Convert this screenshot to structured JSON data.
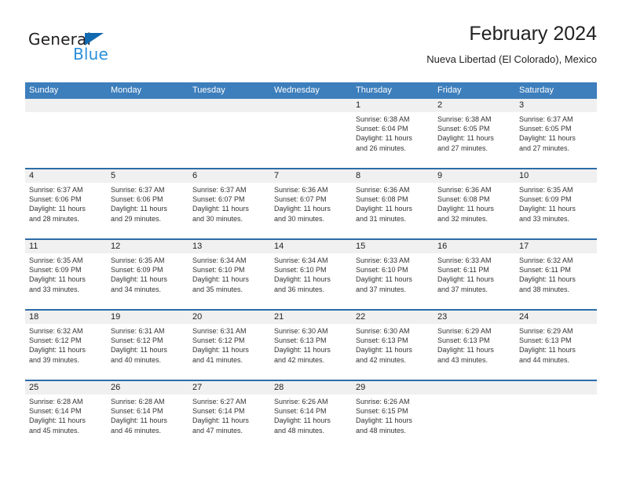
{
  "brand": {
    "name_top": "General",
    "name_bottom": "Blue",
    "triangle_color": "#1169b0",
    "blue_color": "#2a8fdb"
  },
  "header": {
    "title": "February 2024",
    "subtitle": "Nueva Libertad (El Colorado), Mexico"
  },
  "theme": {
    "header_blue": "#3d7ebc",
    "row_divider_blue": "#2d6ca8",
    "daynum_band": "#f0f0f0"
  },
  "calendar": {
    "weekdays": [
      "Sunday",
      "Monday",
      "Tuesday",
      "Wednesday",
      "Thursday",
      "Friday",
      "Saturday"
    ],
    "weeks": [
      [
        {
          "day": "",
          "line1": "",
          "line2": "",
          "line3": "",
          "line4": ""
        },
        {
          "day": "",
          "line1": "",
          "line2": "",
          "line3": "",
          "line4": ""
        },
        {
          "day": "",
          "line1": "",
          "line2": "",
          "line3": "",
          "line4": ""
        },
        {
          "day": "",
          "line1": "",
          "line2": "",
          "line3": "",
          "line4": ""
        },
        {
          "day": "1",
          "line1": "Sunrise: 6:38 AM",
          "line2": "Sunset: 6:04 PM",
          "line3": "Daylight: 11 hours",
          "line4": "and 26 minutes."
        },
        {
          "day": "2",
          "line1": "Sunrise: 6:38 AM",
          "line2": "Sunset: 6:05 PM",
          "line3": "Daylight: 11 hours",
          "line4": "and 27 minutes."
        },
        {
          "day": "3",
          "line1": "Sunrise: 6:37 AM",
          "line2": "Sunset: 6:05 PM",
          "line3": "Daylight: 11 hours",
          "line4": "and 27 minutes."
        }
      ],
      [
        {
          "day": "4",
          "line1": "Sunrise: 6:37 AM",
          "line2": "Sunset: 6:06 PM",
          "line3": "Daylight: 11 hours",
          "line4": "and 28 minutes."
        },
        {
          "day": "5",
          "line1": "Sunrise: 6:37 AM",
          "line2": "Sunset: 6:06 PM",
          "line3": "Daylight: 11 hours",
          "line4": "and 29 minutes."
        },
        {
          "day": "6",
          "line1": "Sunrise: 6:37 AM",
          "line2": "Sunset: 6:07 PM",
          "line3": "Daylight: 11 hours",
          "line4": "and 30 minutes."
        },
        {
          "day": "7",
          "line1": "Sunrise: 6:36 AM",
          "line2": "Sunset: 6:07 PM",
          "line3": "Daylight: 11 hours",
          "line4": "and 30 minutes."
        },
        {
          "day": "8",
          "line1": "Sunrise: 6:36 AM",
          "line2": "Sunset: 6:08 PM",
          "line3": "Daylight: 11 hours",
          "line4": "and 31 minutes."
        },
        {
          "day": "9",
          "line1": "Sunrise: 6:36 AM",
          "line2": "Sunset: 6:08 PM",
          "line3": "Daylight: 11 hours",
          "line4": "and 32 minutes."
        },
        {
          "day": "10",
          "line1": "Sunrise: 6:35 AM",
          "line2": "Sunset: 6:09 PM",
          "line3": "Daylight: 11 hours",
          "line4": "and 33 minutes."
        }
      ],
      [
        {
          "day": "11",
          "line1": "Sunrise: 6:35 AM",
          "line2": "Sunset: 6:09 PM",
          "line3": "Daylight: 11 hours",
          "line4": "and 33 minutes."
        },
        {
          "day": "12",
          "line1": "Sunrise: 6:35 AM",
          "line2": "Sunset: 6:09 PM",
          "line3": "Daylight: 11 hours",
          "line4": "and 34 minutes."
        },
        {
          "day": "13",
          "line1": "Sunrise: 6:34 AM",
          "line2": "Sunset: 6:10 PM",
          "line3": "Daylight: 11 hours",
          "line4": "and 35 minutes."
        },
        {
          "day": "14",
          "line1": "Sunrise: 6:34 AM",
          "line2": "Sunset: 6:10 PM",
          "line3": "Daylight: 11 hours",
          "line4": "and 36 minutes."
        },
        {
          "day": "15",
          "line1": "Sunrise: 6:33 AM",
          "line2": "Sunset: 6:10 PM",
          "line3": "Daylight: 11 hours",
          "line4": "and 37 minutes."
        },
        {
          "day": "16",
          "line1": "Sunrise: 6:33 AM",
          "line2": "Sunset: 6:11 PM",
          "line3": "Daylight: 11 hours",
          "line4": "and 37 minutes."
        },
        {
          "day": "17",
          "line1": "Sunrise: 6:32 AM",
          "line2": "Sunset: 6:11 PM",
          "line3": "Daylight: 11 hours",
          "line4": "and 38 minutes."
        }
      ],
      [
        {
          "day": "18",
          "line1": "Sunrise: 6:32 AM",
          "line2": "Sunset: 6:12 PM",
          "line3": "Daylight: 11 hours",
          "line4": "and 39 minutes."
        },
        {
          "day": "19",
          "line1": "Sunrise: 6:31 AM",
          "line2": "Sunset: 6:12 PM",
          "line3": "Daylight: 11 hours",
          "line4": "and 40 minutes."
        },
        {
          "day": "20",
          "line1": "Sunrise: 6:31 AM",
          "line2": "Sunset: 6:12 PM",
          "line3": "Daylight: 11 hours",
          "line4": "and 41 minutes."
        },
        {
          "day": "21",
          "line1": "Sunrise: 6:30 AM",
          "line2": "Sunset: 6:13 PM",
          "line3": "Daylight: 11 hours",
          "line4": "and 42 minutes."
        },
        {
          "day": "22",
          "line1": "Sunrise: 6:30 AM",
          "line2": "Sunset: 6:13 PM",
          "line3": "Daylight: 11 hours",
          "line4": "and 42 minutes."
        },
        {
          "day": "23",
          "line1": "Sunrise: 6:29 AM",
          "line2": "Sunset: 6:13 PM",
          "line3": "Daylight: 11 hours",
          "line4": "and 43 minutes."
        },
        {
          "day": "24",
          "line1": "Sunrise: 6:29 AM",
          "line2": "Sunset: 6:13 PM",
          "line3": "Daylight: 11 hours",
          "line4": "and 44 minutes."
        }
      ],
      [
        {
          "day": "25",
          "line1": "Sunrise: 6:28 AM",
          "line2": "Sunset: 6:14 PM",
          "line3": "Daylight: 11 hours",
          "line4": "and 45 minutes."
        },
        {
          "day": "26",
          "line1": "Sunrise: 6:28 AM",
          "line2": "Sunset: 6:14 PM",
          "line3": "Daylight: 11 hours",
          "line4": "and 46 minutes."
        },
        {
          "day": "27",
          "line1": "Sunrise: 6:27 AM",
          "line2": "Sunset: 6:14 PM",
          "line3": "Daylight: 11 hours",
          "line4": "and 47 minutes."
        },
        {
          "day": "28",
          "line1": "Sunrise: 6:26 AM",
          "line2": "Sunset: 6:14 PM",
          "line3": "Daylight: 11 hours",
          "line4": "and 48 minutes."
        },
        {
          "day": "29",
          "line1": "Sunrise: 6:26 AM",
          "line2": "Sunset: 6:15 PM",
          "line3": "Daylight: 11 hours",
          "line4": "and 48 minutes."
        },
        {
          "day": "",
          "line1": "",
          "line2": "",
          "line3": "",
          "line4": ""
        },
        {
          "day": "",
          "line1": "",
          "line2": "",
          "line3": "",
          "line4": ""
        }
      ]
    ]
  }
}
